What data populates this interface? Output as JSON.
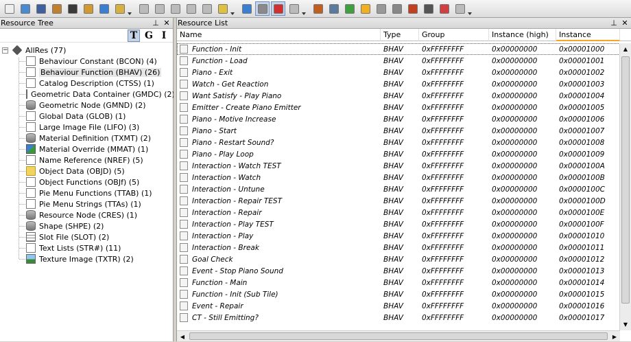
{
  "toolbar": {
    "buttons": [
      {
        "icon": "new-file-icon",
        "color": "#eeeeee"
      },
      {
        "icon": "open-folder-icon",
        "color": "#4a8ad0"
      },
      {
        "icon": "save-icon",
        "color": "#3f5f9f"
      },
      {
        "icon": "save-as-icon",
        "color": "#c08030"
      },
      {
        "icon": "close-icon",
        "color": "#3a3a3a"
      },
      {
        "icon": "plugins-icon",
        "color": "#d09a30"
      },
      {
        "icon": "settings-icon",
        "color": "#3a7fd0"
      },
      {
        "icon": "clipboard-icon",
        "color": "#d8b040"
      },
      {
        "icon": "paste-icon",
        "color": "#bbbbbb"
      },
      {
        "icon": "copy-icon",
        "color": "#bbbbbb"
      },
      {
        "icon": "cut-icon",
        "color": "#bbbbbb"
      },
      {
        "icon": "comment-icon",
        "color": "#bbbbbb"
      },
      {
        "icon": "text-icon",
        "color": "#bbbbbb"
      },
      {
        "icon": "note-icon",
        "color": "#e0c040"
      },
      {
        "icon": "refresh-icon",
        "color": "#3a7fd0"
      },
      {
        "icon": "hex-view-icon",
        "color": "#8a8a8a"
      },
      {
        "icon": "delete-icon",
        "color": "#d03030"
      },
      {
        "icon": "eraser-icon",
        "color": "#bbbbbb"
      },
      {
        "icon": "package-icon",
        "color": "#c06020"
      },
      {
        "icon": "scan-icon",
        "color": "#5a7aa0"
      },
      {
        "icon": "puzzle-icon",
        "color": "#40a040"
      },
      {
        "icon": "object-icon",
        "color": "#f0b020"
      },
      {
        "icon": "document-icon",
        "color": "#999999"
      },
      {
        "icon": "tools-icon",
        "color": "#888888"
      },
      {
        "icon": "wrench-icon",
        "color": "#c04020"
      },
      {
        "icon": "camera-icon",
        "color": "#555555"
      },
      {
        "icon": "users-icon",
        "color": "#d04040"
      },
      {
        "icon": "user-icon",
        "color": "#bbbbbb"
      }
    ]
  },
  "resource_tree": {
    "title": "Resource Tree",
    "pin_glyph": "⊥",
    "close_glyph": "✕",
    "tgi": [
      "T",
      "G",
      "I"
    ],
    "root": {
      "expander": "−",
      "label": "AllRes (77)"
    },
    "items": [
      {
        "label": "Behaviour Constant (BCON) (4)",
        "icon": "ic-doc"
      },
      {
        "label": "Behaviour Function (BHAV) (26)",
        "icon": "ic-doc",
        "selected": true
      },
      {
        "label": "Catalog Description (CTSS) (1)",
        "icon": "ic-doc"
      },
      {
        "label": "Geometric Data Container (GMDC) (2)",
        "icon": "ic-db"
      },
      {
        "label": "Geometric Node (GMND) (2)",
        "icon": "ic-db"
      },
      {
        "label": "Global Data (GLOB) (1)",
        "icon": "ic-doc"
      },
      {
        "label": "Large Image File (LIFO) (3)",
        "icon": "ic-doc"
      },
      {
        "label": "Material Definition (TXMT) (2)",
        "icon": "ic-db"
      },
      {
        "label": "Material Override (MMAT) (1)",
        "icon": "ic-mmat"
      },
      {
        "label": "Name Reference (NREF) (5)",
        "icon": "ic-doc"
      },
      {
        "label": "Object Data (OBJD) (5)",
        "icon": "ic-folder"
      },
      {
        "label": "Object Functions (OBJf) (5)",
        "icon": "ic-doc"
      },
      {
        "label": "Pie Menu Functions (TTAB) (1)",
        "icon": "ic-doc"
      },
      {
        "label": "Pie Menu Strings (TTAs) (1)",
        "icon": "ic-doc"
      },
      {
        "label": "Resource Node (CRES) (1)",
        "icon": "ic-db"
      },
      {
        "label": "Shape (SHPE) (2)",
        "icon": "ic-db"
      },
      {
        "label": "Slot File (SLOT) (2)",
        "icon": "ic-grid"
      },
      {
        "label": "Text Lists (STR#) (11)",
        "icon": "ic-doc"
      },
      {
        "label": "Texture Image (TXTR) (2)",
        "icon": "ic-img"
      }
    ]
  },
  "resource_list": {
    "title": "Resource List",
    "pin_glyph": "⊥",
    "close_glyph": "✕",
    "columns": [
      "Name",
      "Type",
      "Group",
      "Instance (high)",
      "Instance"
    ],
    "rows": [
      [
        "Function - Init",
        "BHAV",
        "0xFFFFFFFF",
        "0x00000000",
        "0x00001000"
      ],
      [
        "Function - Load",
        "BHAV",
        "0xFFFFFFFF",
        "0x00000000",
        "0x00001001"
      ],
      [
        "Piano - Exit",
        "BHAV",
        "0xFFFFFFFF",
        "0x00000000",
        "0x00001002"
      ],
      [
        "Watch - Get Reaction",
        "BHAV",
        "0xFFFFFFFF",
        "0x00000000",
        "0x00001003"
      ],
      [
        "Want Satisfy - Play Piano",
        "BHAV",
        "0xFFFFFFFF",
        "0x00000000",
        "0x00001004"
      ],
      [
        "Emitter - Create Piano Emitter",
        "BHAV",
        "0xFFFFFFFF",
        "0x00000000",
        "0x00001005"
      ],
      [
        "Piano - Motive Increase",
        "BHAV",
        "0xFFFFFFFF",
        "0x00000000",
        "0x00001006"
      ],
      [
        "Piano - Start",
        "BHAV",
        "0xFFFFFFFF",
        "0x00000000",
        "0x00001007"
      ],
      [
        "Piano - Restart Sound?",
        "BHAV",
        "0xFFFFFFFF",
        "0x00000000",
        "0x00001008"
      ],
      [
        "Piano - Play Loop",
        "BHAV",
        "0xFFFFFFFF",
        "0x00000000",
        "0x00001009"
      ],
      [
        "Interaction - Watch TEST",
        "BHAV",
        "0xFFFFFFFF",
        "0x00000000",
        "0x0000100A"
      ],
      [
        "Interaction - Watch",
        "BHAV",
        "0xFFFFFFFF",
        "0x00000000",
        "0x0000100B"
      ],
      [
        "Interaction - Untune",
        "BHAV",
        "0xFFFFFFFF",
        "0x00000000",
        "0x0000100C"
      ],
      [
        "Interaction - Repair TEST",
        "BHAV",
        "0xFFFFFFFF",
        "0x00000000",
        "0x0000100D"
      ],
      [
        "Interaction - Repair",
        "BHAV",
        "0xFFFFFFFF",
        "0x00000000",
        "0x0000100E"
      ],
      [
        "Interaction - Play TEST",
        "BHAV",
        "0xFFFFFFFF",
        "0x00000000",
        "0x0000100F"
      ],
      [
        "Interaction - Play",
        "BHAV",
        "0xFFFFFFFF",
        "0x00000000",
        "0x00001010"
      ],
      [
        "Interaction - Break",
        "BHAV",
        "0xFFFFFFFF",
        "0x00000000",
        "0x00001011"
      ],
      [
        "Goal Check",
        "BHAV",
        "0xFFFFFFFF",
        "0x00000000",
        "0x00001012"
      ],
      [
        "Event - Stop Piano Sound",
        "BHAV",
        "0xFFFFFFFF",
        "0x00000000",
        "0x00001013"
      ],
      [
        "Function - Main",
        "BHAV",
        "0xFFFFFFFF",
        "0x00000000",
        "0x00001014"
      ],
      [
        "Function - Init (Sub Tile)",
        "BHAV",
        "0xFFFFFFFF",
        "0x00000000",
        "0x00001015"
      ],
      [
        "Event - Repair",
        "BHAV",
        "0xFFFFFFFF",
        "0x00000000",
        "0x00001016"
      ],
      [
        "CT - Still Emitting?",
        "BHAV",
        "0xFFFFFFFF",
        "0x00000000",
        "0x00001017"
      ]
    ],
    "scroll_up": "▲",
    "scroll_down": "▼",
    "scroll_left": "◀",
    "scroll_right": "▶"
  }
}
